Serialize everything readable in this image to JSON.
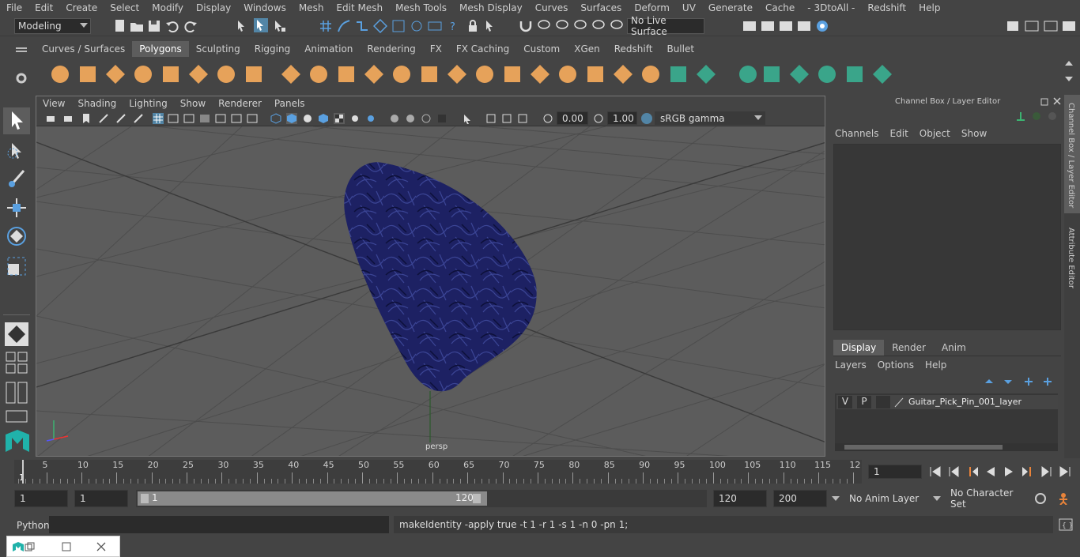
{
  "menu": [
    "File",
    "Edit",
    "Create",
    "Select",
    "Modify",
    "Display",
    "Windows",
    "Mesh",
    "Edit Mesh",
    "Mesh Tools",
    "Mesh Display",
    "Curves",
    "Surfaces",
    "Deform",
    "UV",
    "Generate",
    "Cache",
    "- 3DtoAll -",
    "Redshift",
    "Help"
  ],
  "status": {
    "workspace": "Modeling",
    "live_surface": "No Live Surface"
  },
  "shelf_tabs": [
    "Curves / Surfaces",
    "Polygons",
    "Sculpting",
    "Rigging",
    "Animation",
    "Rendering",
    "FX",
    "FX Caching",
    "Custom",
    "XGen",
    "Redshift",
    "Bullet"
  ],
  "viewport": {
    "menu": [
      "View",
      "Shading",
      "Lighting",
      "Show",
      "Renderer",
      "Panels"
    ],
    "exposure": "0.00",
    "gamma": "1.00",
    "color_space": "sRGB gamma",
    "camera": "persp"
  },
  "channel_box": {
    "title": "Channel Box / Layer Editor",
    "menu": [
      "Channels",
      "Edit",
      "Object",
      "Show"
    ],
    "layer_tabs": [
      "Display",
      "Render",
      "Anim"
    ],
    "layer_menu": [
      "Layers",
      "Options",
      "Help"
    ],
    "layer": {
      "v": "V",
      "p": "P",
      "name": "Guitar_Pick_Pin_001_layer"
    }
  },
  "side_tabs": [
    "Channel Box / Layer Editor",
    "Attribute Editor"
  ],
  "timeline": {
    "ticks": [
      "5",
      "10",
      "15",
      "20",
      "25",
      "30",
      "35",
      "40",
      "45",
      "50",
      "55",
      "60",
      "65",
      "70",
      "75",
      "80",
      "85",
      "90",
      "95",
      "100",
      "105",
      "110",
      "115",
      "12"
    ],
    "start_marker": "1",
    "current": "1"
  },
  "range": {
    "start": "1",
    "inner_start": "1",
    "slider_start": "1",
    "slider_end": "120",
    "end": "120",
    "max": "200",
    "anim_layer": "No Anim Layer",
    "char_set": "No Character Set"
  },
  "cmd": {
    "lang": "Python",
    "output": "makeIdentity -apply true -t 1 -r 1 -s 1 -n 0 -pn 1;"
  },
  "colors": {
    "accent": "#5285a6",
    "pick": "#1b1f5a",
    "bg": "#444444"
  }
}
